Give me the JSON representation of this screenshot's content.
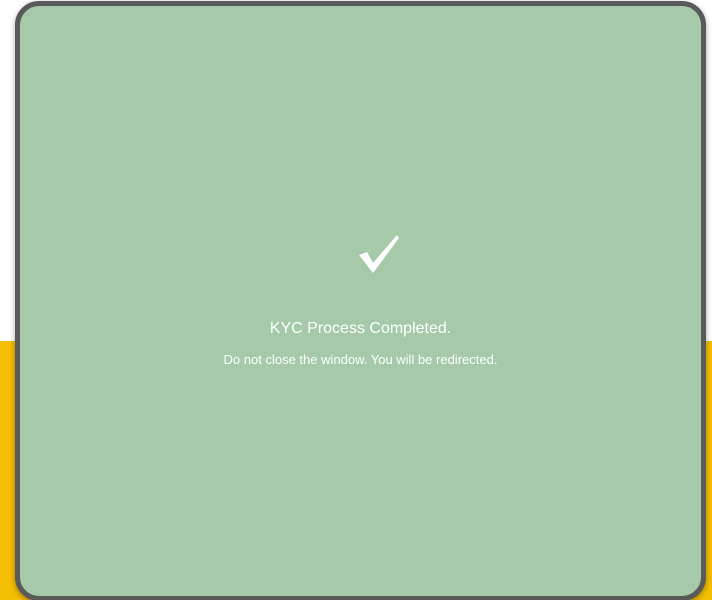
{
  "backdrop": {
    "top_color": "#ffffff",
    "bottom_color": "#f4be02"
  },
  "modal": {
    "background_color": "#a5c9a9",
    "border_color": "#595959",
    "icon": "checkmark-icon",
    "title": "KYC Process Completed.",
    "message": "Do not close the window. You will be redirected."
  }
}
